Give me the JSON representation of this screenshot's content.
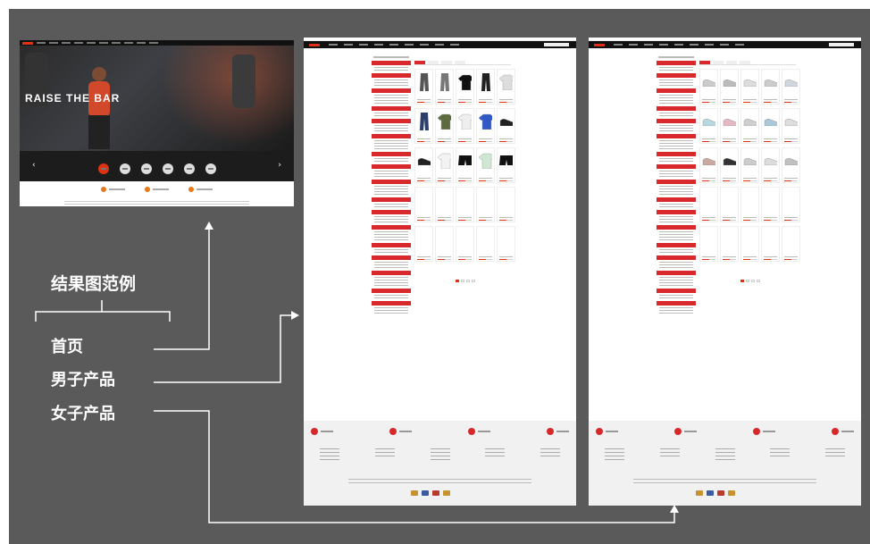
{
  "labels": {
    "example": "结果图范例",
    "home": "首页",
    "men": "男子产品",
    "women": "女子产品"
  },
  "hero": {
    "slogan": "RAISE THE BAR"
  },
  "colors": {
    "board": "#5b5a5a",
    "accent": "#d8282b",
    "connector": "#ffffff"
  },
  "men_products": [
    {
      "shape": "pants",
      "color": "#555"
    },
    {
      "shape": "pants",
      "color": "#777"
    },
    {
      "shape": "top",
      "color": "#111"
    },
    {
      "shape": "pants",
      "color": "#222"
    },
    {
      "shape": "top",
      "color": "#ddd"
    },
    {
      "shape": "pants",
      "color": "#2c3f6b"
    },
    {
      "shape": "top",
      "color": "#5d6b3e"
    },
    {
      "shape": "top",
      "color": "#eee"
    },
    {
      "shape": "top",
      "color": "#2f59c7"
    },
    {
      "shape": "shoe",
      "color": "#222"
    },
    {
      "shape": "shoe",
      "color": "#222"
    },
    {
      "shape": "top",
      "color": "#f3f3f3"
    },
    {
      "shape": "shorts",
      "color": "#111"
    },
    {
      "shape": "top",
      "color": "#cfe7d2"
    },
    {
      "shape": "shorts",
      "color": "#111"
    },
    {
      "shape": "empty",
      "color": "#fff"
    },
    {
      "shape": "empty",
      "color": "#fff"
    },
    {
      "shape": "empty",
      "color": "#fff"
    },
    {
      "shape": "empty",
      "color": "#fff"
    },
    {
      "shape": "empty",
      "color": "#fff"
    },
    {
      "shape": "empty",
      "color": "#fff"
    },
    {
      "shape": "empty",
      "color": "#fff"
    },
    {
      "shape": "empty",
      "color": "#fff"
    },
    {
      "shape": "empty",
      "color": "#fff"
    },
    {
      "shape": "empty",
      "color": "#fff"
    }
  ],
  "women_products": [
    {
      "shape": "shoe",
      "color": "#ccc"
    },
    {
      "shape": "shoe",
      "color": "#bbb"
    },
    {
      "shape": "shoe",
      "color": "#ddd"
    },
    {
      "shape": "shoe",
      "color": "#ccc"
    },
    {
      "shape": "shoe",
      "color": "#d0d6e0"
    },
    {
      "shape": "shoe",
      "color": "#b8d8e0"
    },
    {
      "shape": "shoe",
      "color": "#e6b8c4"
    },
    {
      "shape": "shoe",
      "color": "#cfcfcf"
    },
    {
      "shape": "shoe",
      "color": "#aac8d8"
    },
    {
      "shape": "shoe",
      "color": "#ddd"
    },
    {
      "shape": "shoe",
      "color": "#c9a9a0"
    },
    {
      "shape": "shoe",
      "color": "#333"
    },
    {
      "shape": "shoe",
      "color": "#ccc"
    },
    {
      "shape": "shoe",
      "color": "#ddd"
    },
    {
      "shape": "shoe",
      "color": "#c0c0c0"
    },
    {
      "shape": "empty",
      "color": "#fff"
    },
    {
      "shape": "empty",
      "color": "#fff"
    },
    {
      "shape": "empty",
      "color": "#fff"
    },
    {
      "shape": "empty",
      "color": "#fff"
    },
    {
      "shape": "empty",
      "color": "#fff"
    },
    {
      "shape": "empty",
      "color": "#fff"
    },
    {
      "shape": "empty",
      "color": "#fff"
    },
    {
      "shape": "empty",
      "color": "#fff"
    },
    {
      "shape": "empty",
      "color": "#fff"
    },
    {
      "shape": "empty",
      "color": "#fff"
    }
  ]
}
